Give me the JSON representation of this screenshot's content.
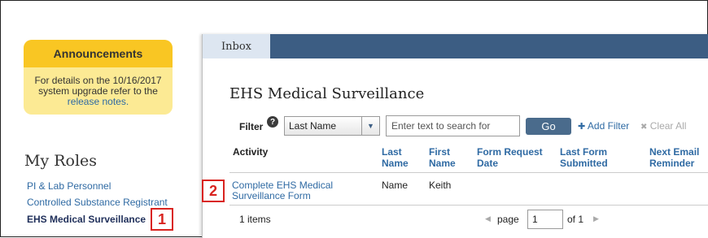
{
  "announcements": {
    "title": "Announcements",
    "body": "For details on the 10/16/2017 system upgrade refer to the",
    "link": "release notes."
  },
  "roles": {
    "title": "My Roles",
    "items": [
      {
        "label": "PI & Lab Personnel"
      },
      {
        "label": "Controlled Substance Registrant"
      },
      {
        "label": "EHS Medical Surveillance"
      }
    ]
  },
  "callouts": [
    "1",
    "2"
  ],
  "tabs": [
    {
      "label": "Inbox"
    }
  ],
  "page_title": "EHS Medical Surveillance",
  "filter": {
    "label": "Filter",
    "help_glyph": "?",
    "selected": "Last Name",
    "placeholder": "Enter text to search for",
    "go_label": "Go",
    "add_filter": "Add Filter",
    "clear_all": "Clear All",
    "add_glyph": "✚",
    "clear_glyph": "✖"
  },
  "table": {
    "columns": [
      {
        "line1": "Activity",
        "line2": ""
      },
      {
        "line1": "Last",
        "line2": "Name"
      },
      {
        "line1": "First",
        "line2": "Name"
      },
      {
        "line1": "Form Request",
        "line2": "Date"
      },
      {
        "line1": "Last Form",
        "line2": "Submitted"
      },
      {
        "line1": "Next Email",
        "line2": "Reminder"
      }
    ],
    "rows": [
      {
        "activity_line1": "Complete EHS Medical",
        "activity_line2": "Surveillance Form",
        "last_name": "Name",
        "first_name": "Keith",
        "form_request_date": "",
        "last_form_submitted": "",
        "next_email_reminder": ""
      }
    ]
  },
  "pager": {
    "items": "1 items",
    "page_label": "page",
    "page_value": "1",
    "of_label": "of 1"
  },
  "colors": {
    "tabbar": "#3c5d83",
    "announcement_header": "#f9c623",
    "announcement_body": "#fcea94",
    "link": "#2f6aa3",
    "callout": "#d9231f"
  }
}
